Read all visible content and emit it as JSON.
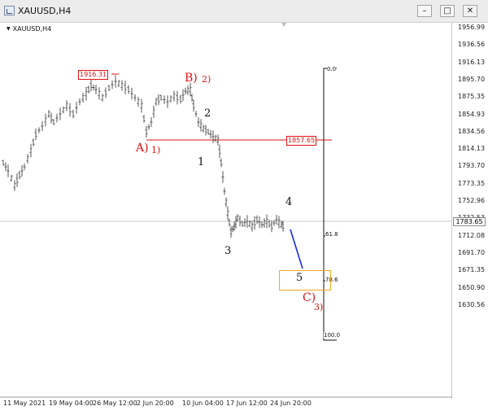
{
  "window": {
    "title": "XAUUSD,H4",
    "buttons": [
      "minimize",
      "maximize",
      "close"
    ]
  },
  "chart": {
    "symbol_label": "XAUUSD,H4",
    "current_price": "1783.65",
    "level_high": "1916.31",
    "level_mid": "1857.65",
    "y_ticks": [
      "1956.99",
      "1936.56",
      "1916.13",
      "1895.70",
      "1875.35",
      "1854.93",
      "1834.56",
      "1814.13",
      "1793.70",
      "1773.35",
      "1752.96",
      "1732.53",
      "1712.08",
      "1691.70",
      "1671.35",
      "1650.90",
      "1630.56"
    ],
    "x_ticks": [
      "11 May 2021",
      "19 May 04:00",
      "26 May 12:00",
      "2 Jun 20:00",
      "10 Jun 04:00",
      "17 Jun 12:00",
      "24 Jun 20:00"
    ],
    "fib_levels": [
      "0.0",
      "61.8",
      "78.6",
      "100.0"
    ],
    "wave_labels": {
      "A": "A)",
      "A_sub": "1)",
      "B": "B)",
      "B_sub": "2)",
      "C": "C)",
      "C_sub": "3)",
      "w1": "1",
      "w2": "2",
      "w3": "3",
      "w4": "4",
      "w5": "5"
    },
    "colors": {
      "bars": "#555555",
      "red_line": "#e01010",
      "projection": "#1a2ae8",
      "target_box": "#f2a91d",
      "current_line": "#c8c8c8"
    }
  }
}
